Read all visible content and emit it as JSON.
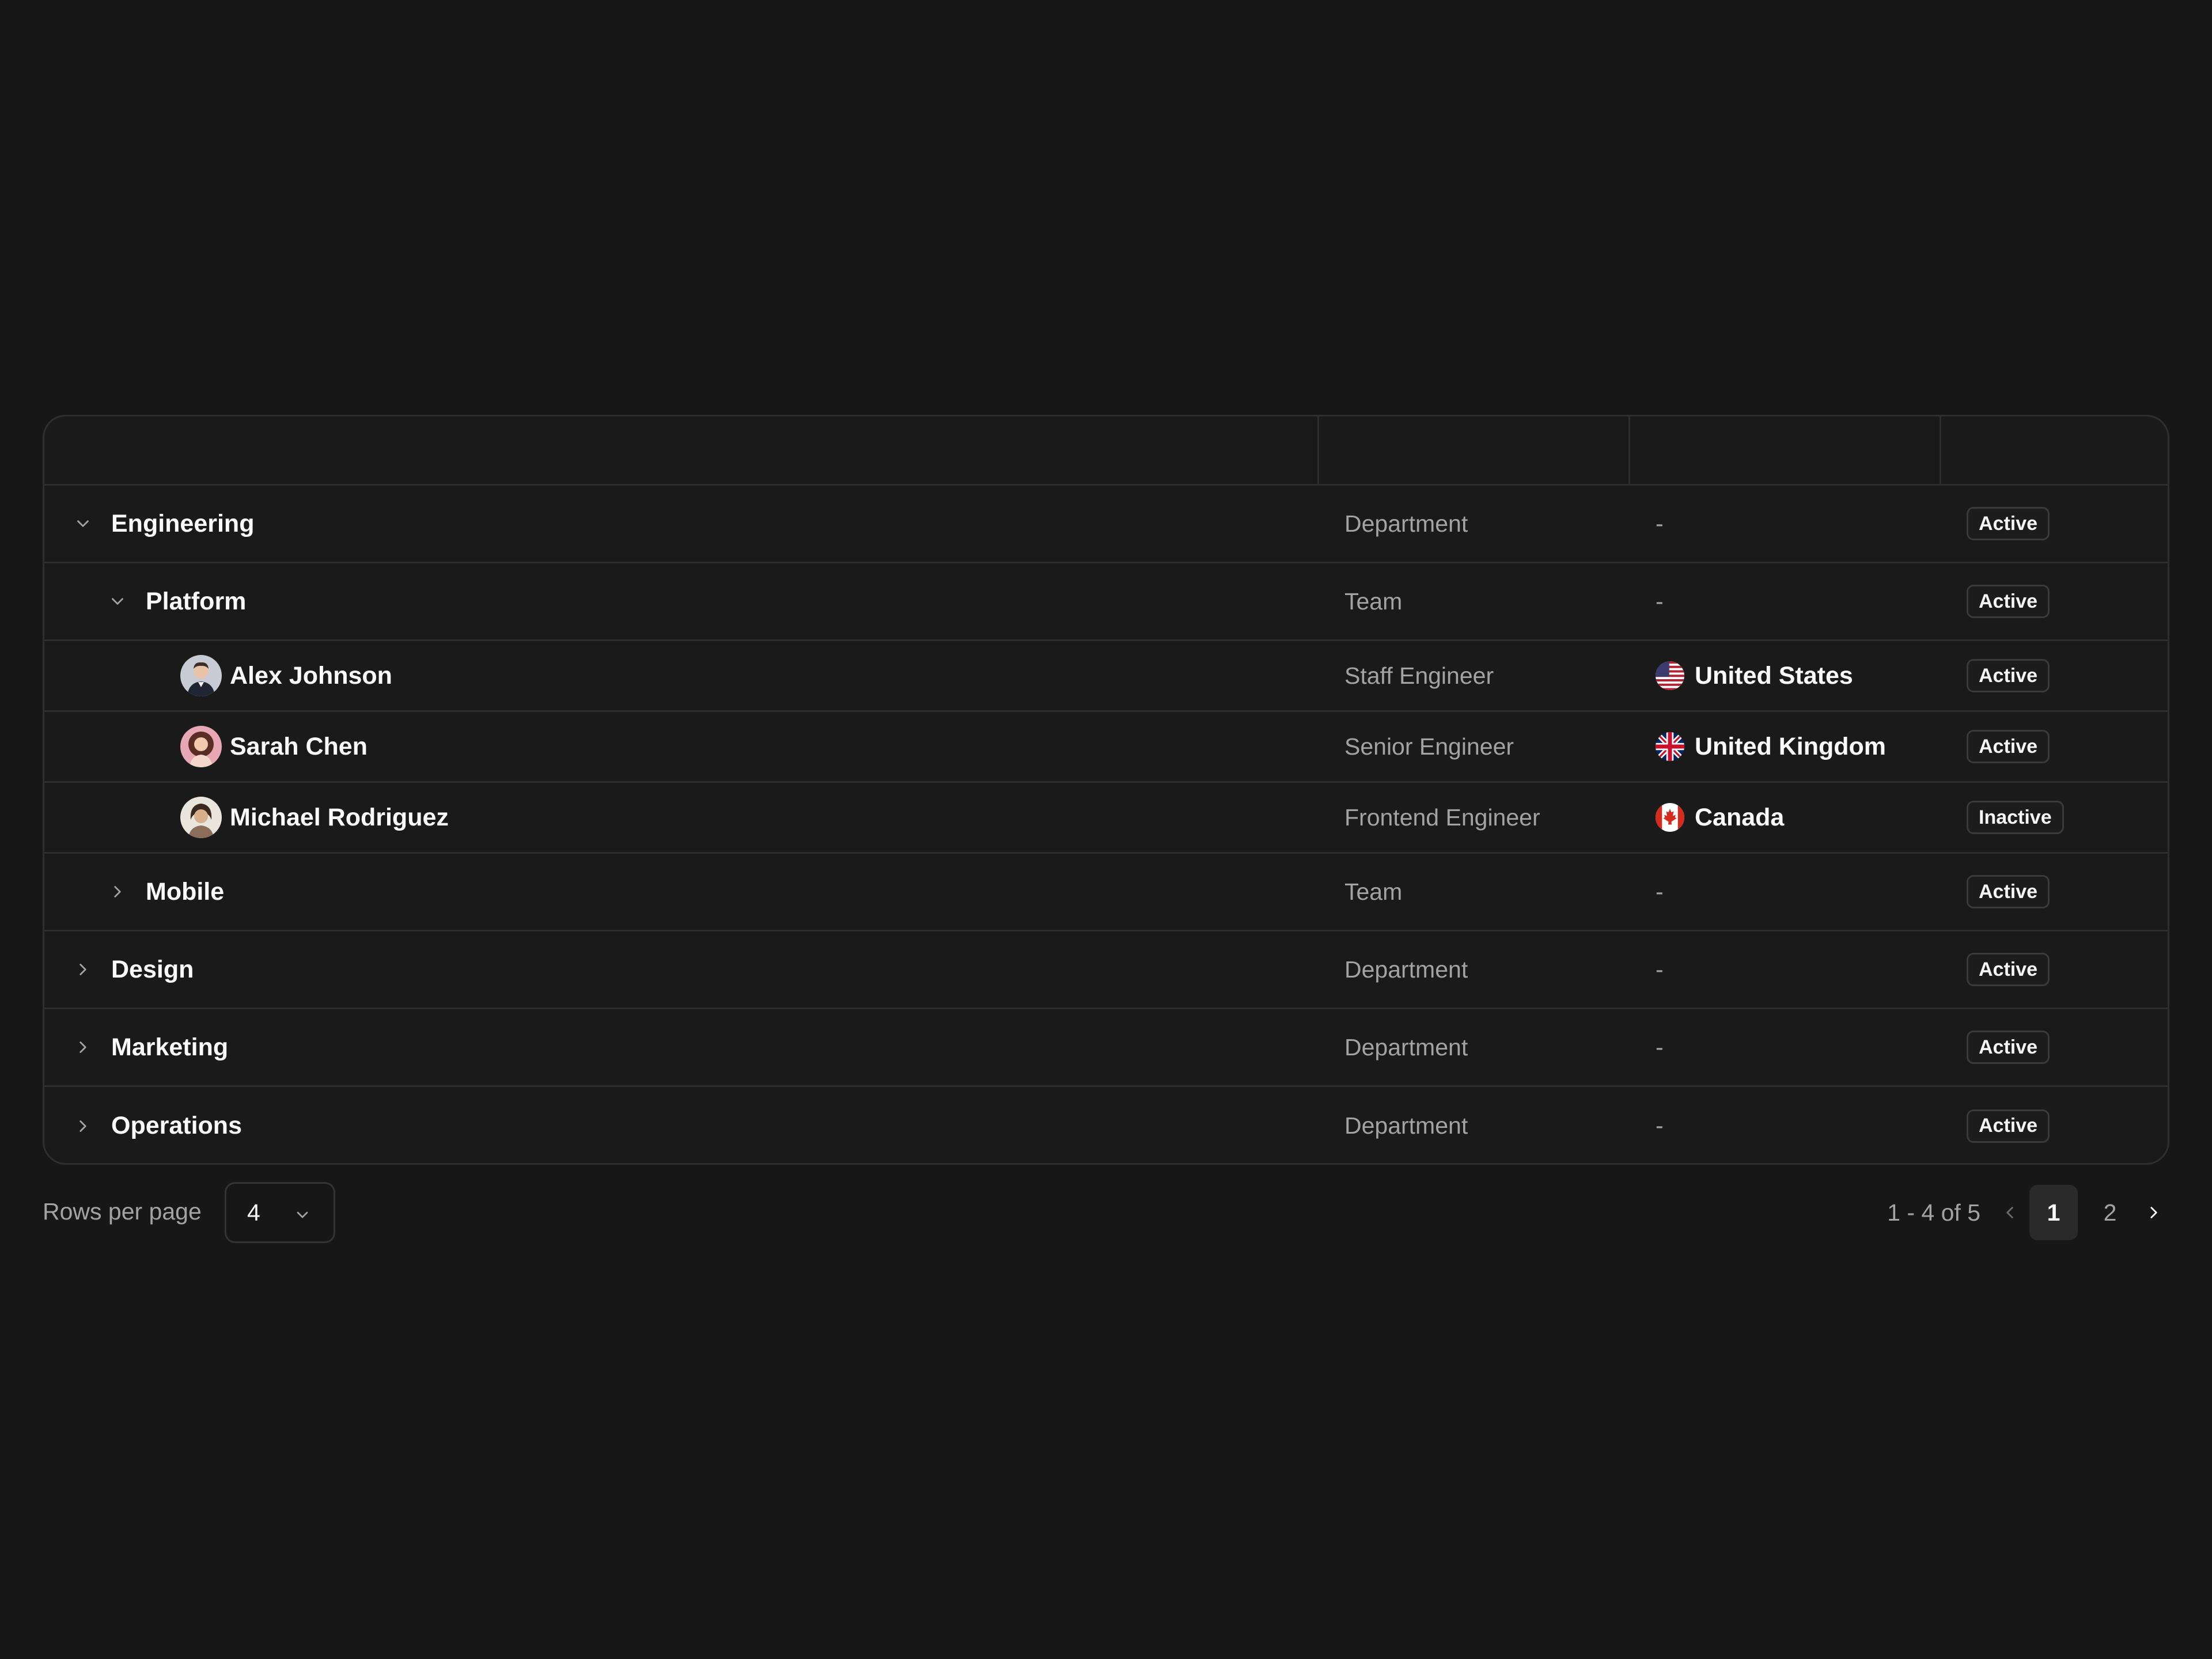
{
  "table": {
    "header": [
      "",
      "",
      "",
      ""
    ],
    "rows": [
      {
        "kind": "group",
        "level": 0,
        "expanded": true,
        "name": "Engineering",
        "role": "Department",
        "country": "-",
        "status": "Active"
      },
      {
        "kind": "group",
        "level": 1,
        "expanded": true,
        "name": "Platform",
        "role": "Team",
        "country": "-",
        "status": "Active"
      },
      {
        "kind": "person",
        "name": "Alex Johnson",
        "role": "Staff Engineer",
        "country": "United States",
        "flag": "us-flag-icon",
        "status": "Active"
      },
      {
        "kind": "person",
        "name": "Sarah Chen",
        "role": "Senior Engineer",
        "country": "United Kingdom",
        "flag": "uk-flag-icon",
        "status": "Active"
      },
      {
        "kind": "person",
        "name": "Michael Rodriguez",
        "role": "Frontend Engineer",
        "country": "Canada",
        "flag": "canada-flag-icon",
        "status": "Inactive"
      },
      {
        "kind": "group",
        "level": 1,
        "expanded": false,
        "name": "Mobile",
        "role": "Team",
        "country": "-",
        "status": "Active"
      },
      {
        "kind": "group",
        "level": 0,
        "expanded": false,
        "name": "Design",
        "role": "Department",
        "country": "-",
        "status": "Active"
      },
      {
        "kind": "group",
        "level": 0,
        "expanded": false,
        "name": "Marketing",
        "role": "Department",
        "country": "-",
        "status": "Active"
      },
      {
        "kind": "group",
        "level": 0,
        "expanded": false,
        "name": "Operations",
        "role": "Department",
        "country": "-",
        "status": "Active"
      }
    ]
  },
  "footer": {
    "rows_per_page_label": "Rows per page",
    "rows_per_page_value": "4",
    "range_text": "1 - 4 of 5",
    "pages": [
      "1",
      "2"
    ],
    "current_page": "1"
  },
  "colors": {
    "background": "#171717",
    "border": "#2e2e2e",
    "text_primary": "#fafafa",
    "text_muted": "#a3a3a3"
  }
}
